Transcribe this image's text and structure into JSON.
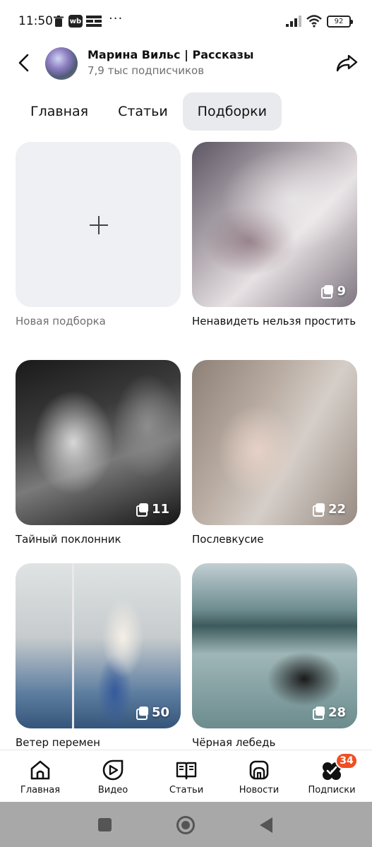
{
  "status_bar": {
    "time": "11:50",
    "wb_label": "wb",
    "more": "···",
    "battery": "92"
  },
  "header": {
    "channel_name": "Марина Вильс | Рассказы",
    "subscribers": "7,9 тыс подписчиков"
  },
  "tabs": [
    {
      "label": "Главная",
      "active": false
    },
    {
      "label": "Статьи",
      "active": false
    },
    {
      "label": "Подборки",
      "active": true
    }
  ],
  "collections": {
    "new_label": "Новая подборка",
    "items": [
      {
        "title": "Ненавидеть нельзя простить",
        "count": "9"
      },
      {
        "title": "Тайный поклонник",
        "count": "11"
      },
      {
        "title": "Послевкусие",
        "count": "22"
      },
      {
        "title": "Ветер перемен",
        "count": "50"
      },
      {
        "title": "Чёрная лебедь",
        "count": "28"
      }
    ]
  },
  "bottom_nav": {
    "items": [
      {
        "label": "Главная",
        "icon": "home-icon"
      },
      {
        "label": "Видео",
        "icon": "play-icon"
      },
      {
        "label": "Статьи",
        "icon": "book-icon"
      },
      {
        "label": "Новости",
        "icon": "news-icon"
      },
      {
        "label": "Подписки",
        "icon": "subscriptions-icon"
      }
    ],
    "badge": "34"
  },
  "colors": {
    "accent_badge": "#f04e23",
    "tab_active_bg": "#e9eaee",
    "placeholder_bg": "#eef0f3"
  }
}
